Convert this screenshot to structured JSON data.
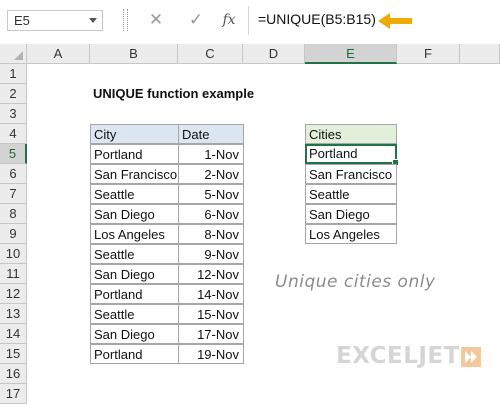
{
  "formula_bar": {
    "name_box": "E5",
    "cancel_icon": "✕",
    "enter_icon": "✓",
    "fx_label": "fx",
    "formula": "=UNIQUE(B5:B15)",
    "arrow_color": "#f2a900"
  },
  "columns": [
    "A",
    "B",
    "C",
    "D",
    "E",
    "F"
  ],
  "rows": [
    "1",
    "2",
    "3",
    "4",
    "5",
    "6",
    "7",
    "8",
    "9",
    "10",
    "11",
    "12",
    "13",
    "14",
    "15",
    "16",
    "17"
  ],
  "selected": {
    "column": "E",
    "row": "5"
  },
  "title": "UNIQUE function example",
  "source_table": {
    "headers": [
      "City",
      "Date"
    ],
    "rows": [
      [
        "Portland",
        "1-Nov"
      ],
      [
        "San Francisco",
        "2-Nov"
      ],
      [
        "Seattle",
        "5-Nov"
      ],
      [
        "San Diego",
        "6-Nov"
      ],
      [
        "Los Angeles",
        "8-Nov"
      ],
      [
        "Seattle",
        "9-Nov"
      ],
      [
        "San Diego",
        "12-Nov"
      ],
      [
        "Portland",
        "14-Nov"
      ],
      [
        "Seattle",
        "15-Nov"
      ],
      [
        "San Diego",
        "17-Nov"
      ],
      [
        "Portland",
        "19-Nov"
      ]
    ]
  },
  "result_table": {
    "header": "Cities",
    "rows": [
      "Portland",
      "San Francisco",
      "Seattle",
      "San Diego",
      "Los Angeles"
    ]
  },
  "note": "Unique cities only",
  "logo": "EXCELJET",
  "colors": {
    "source_header_bg": "#dce6f1",
    "result_header_bg": "#e2efda",
    "selection": "#217346"
  }
}
